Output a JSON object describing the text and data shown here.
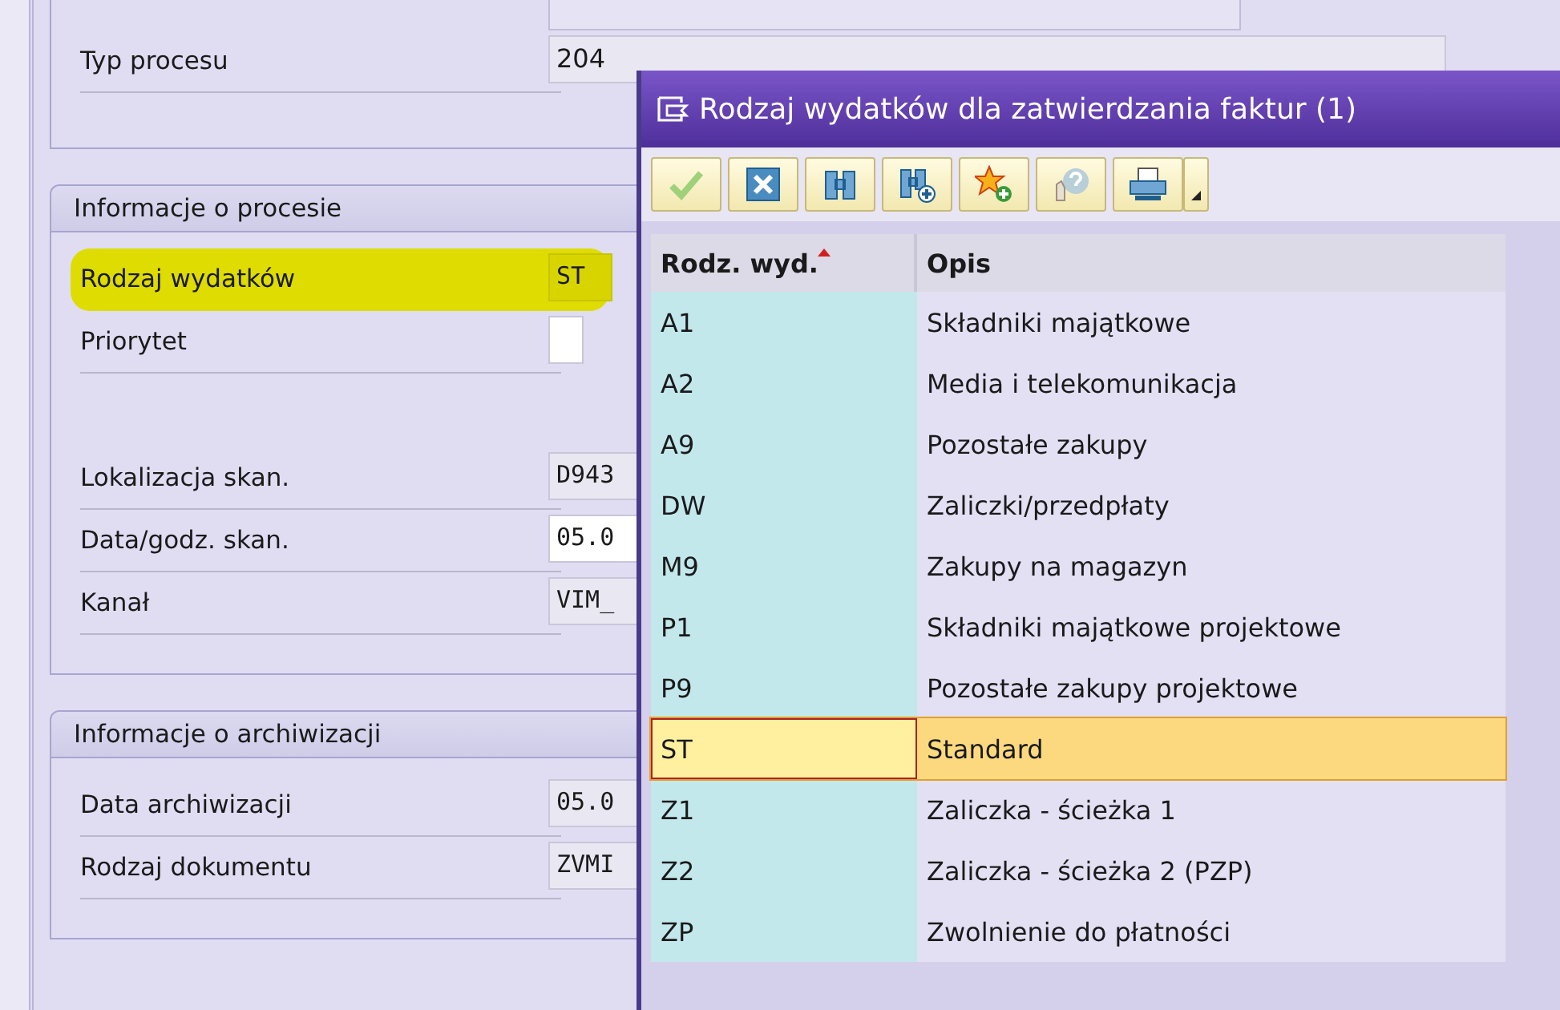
{
  "form": {
    "process_type": {
      "label": "Typ procesu",
      "value": "204"
    },
    "groups": [
      {
        "title": "Informacje o procesie",
        "sections": [
          [
            {
              "label": "Rodzaj wydatków",
              "value": "ST",
              "editable": false,
              "highlighted": true
            },
            {
              "label": "Priorytet",
              "editable": true,
              "highlighted": false
            }
          ],
          [
            {
              "label": "Lokalizacja skan.",
              "value": "D943",
              "editable": false,
              "highlighted": false
            },
            {
              "label": "Data/godz. skan.",
              "value": "05.0",
              "editable": true,
              "highlighted": false
            },
            {
              "label": "Kanał",
              "value": "VIM_",
              "editable": false,
              "highlighted": false
            }
          ]
        ]
      },
      {
        "title": "Informacje o archiwizacji",
        "sections": [
          [
            {
              "label": "Data archiwizacji",
              "value": "05.0",
              "editable": false,
              "highlighted": false
            },
            {
              "label": "Rodzaj dokumentu",
              "value": "ZVMI",
              "editable": false,
              "highlighted": false
            }
          ]
        ]
      }
    ]
  },
  "dialog": {
    "title": "Rodzaj wydatków dla zatwierdzania faktur (1)",
    "toolbar": [
      {
        "kind": "check"
      },
      {
        "kind": "cancel"
      },
      {
        "kind": "find"
      },
      {
        "kind": "find-next"
      },
      {
        "kind": "favorite-add"
      },
      {
        "kind": "help"
      },
      {
        "kind": "print"
      },
      {
        "kind": "menu"
      }
    ],
    "columns": [
      {
        "label": "Rodz. wyd.",
        "sorted": true
      },
      {
        "label": "Opis",
        "sorted": false
      }
    ],
    "rows": [
      {
        "code": "A1",
        "description": "Składniki majątkowe",
        "selected": false
      },
      {
        "code": "A2",
        "description": "Media i telekomunikacja",
        "selected": false
      },
      {
        "code": "A9",
        "description": "Pozostałe zakupy",
        "selected": false
      },
      {
        "code": "DW",
        "description": "Zaliczki/przedpłaty",
        "selected": false
      },
      {
        "code": "M9",
        "description": "Zakupy na magazyn",
        "selected": false
      },
      {
        "code": "P1",
        "description": "Składniki majątkowe projektowe",
        "selected": false
      },
      {
        "code": "P9",
        "description": "Pozostałe zakupy projektowe",
        "selected": false
      },
      {
        "code": "ST",
        "description": "Standard",
        "selected": true
      },
      {
        "code": "Z1",
        "description": "Zaliczka  - ścieżka 1",
        "selected": false
      },
      {
        "code": "Z2",
        "description": "Zaliczka  - ścieżka 2 (PZP)",
        "selected": false
      },
      {
        "code": "ZP",
        "description": "Zwolnienie do płatności",
        "selected": false
      }
    ]
  }
}
